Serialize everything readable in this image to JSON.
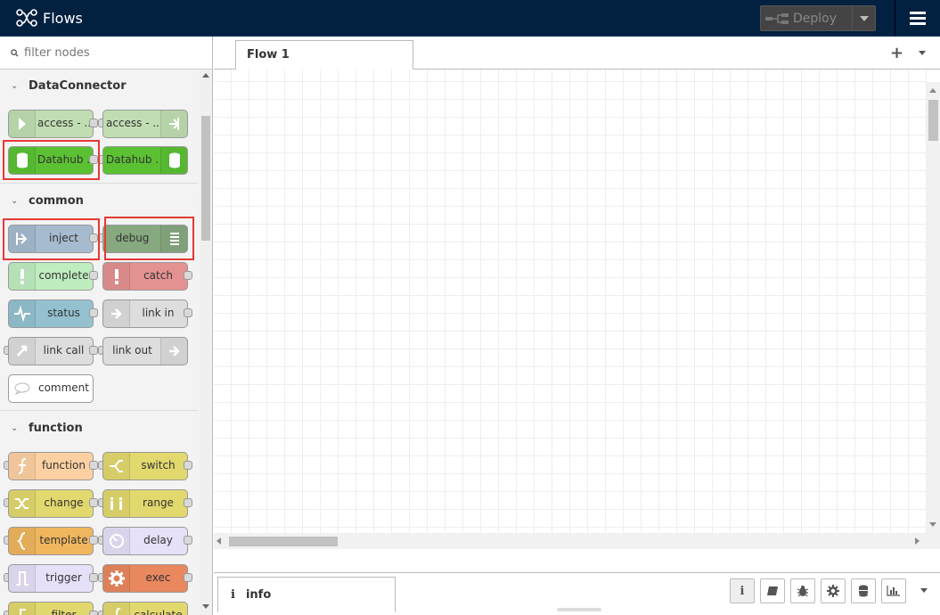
{
  "header": {
    "title": "Flows",
    "deploy_label": "Deploy"
  },
  "palette": {
    "filter_placeholder": "filter nodes",
    "categories": [
      {
        "name": "DataConnector",
        "nodes": [
          {
            "label": "access - ...",
            "icon": "arrow-in-icon",
            "color": "#c0deb2"
          },
          {
            "label": "access - ...",
            "icon": "arrow-out-icon",
            "color": "#c0deb2"
          },
          {
            "label": "Datahub ...",
            "icon": "database-icon",
            "color": "#5bc133"
          },
          {
            "label": "Datahub ...",
            "icon": "database-icon",
            "color": "#5bc133"
          }
        ]
      },
      {
        "name": "common",
        "nodes": [
          {
            "label": "inject",
            "icon": "arrow-in-icon",
            "color": "#a6bbcf"
          },
          {
            "label": "debug",
            "icon": "list-icon",
            "color": "#87a980"
          },
          {
            "label": "complete",
            "icon": "alert-icon",
            "color": "#c0edc0"
          },
          {
            "label": "catch",
            "icon": "alert-icon",
            "color": "#e49191"
          },
          {
            "label": "status",
            "icon": "pulse-icon",
            "color": "#94c1d0"
          },
          {
            "label": "link in",
            "icon": "link-icon",
            "color": "#dddddd"
          },
          {
            "label": "link call",
            "icon": "link-icon",
            "color": "#dddddd"
          },
          {
            "label": "link out",
            "icon": "link-icon",
            "color": "#dddddd"
          },
          {
            "label": "comment",
            "icon": "comment-icon",
            "color": "#ffffff"
          }
        ]
      },
      {
        "name": "function",
        "nodes": [
          {
            "label": "function",
            "icon": "function-icon",
            "color": "#fdd0a2"
          },
          {
            "label": "switch",
            "icon": "switch-icon",
            "color": "#e2d96e"
          },
          {
            "label": "change",
            "icon": "shuffle-icon",
            "color": "#e2d96e"
          },
          {
            "label": "range",
            "icon": "range-icon",
            "color": "#e2d96e"
          },
          {
            "label": "template",
            "icon": "template-icon",
            "color": "#f0b65e"
          },
          {
            "label": "delay",
            "icon": "timer-icon",
            "color": "#e6e0f8"
          },
          {
            "label": "trigger",
            "icon": "trigger-icon",
            "color": "#e6e0f8"
          },
          {
            "label": "exec",
            "icon": "gear-icon",
            "color": "#e9875f"
          },
          {
            "label": "filter",
            "icon": "filter-icon",
            "color": "#e2d96e"
          },
          {
            "label": "calculate",
            "icon": "function-icon",
            "color": "#e2d96e"
          }
        ]
      }
    ]
  },
  "workspace": {
    "tab_label": "Flow 1"
  },
  "sidebar": {
    "tab_label": "info"
  }
}
